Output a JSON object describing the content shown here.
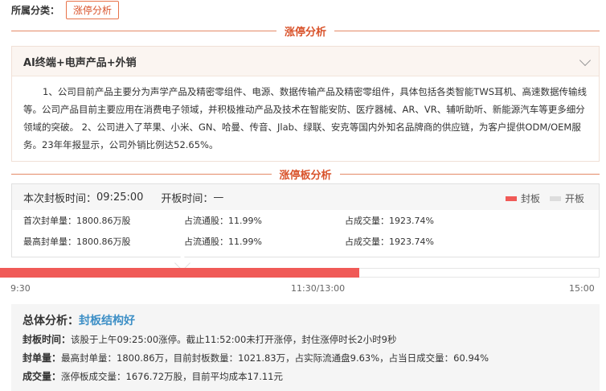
{
  "category": {
    "label": "所属分类：",
    "tag": "涨停分析"
  },
  "section1": {
    "title": "涨停分析"
  },
  "topic": {
    "title": "AI终端+电声产品+外销",
    "body": "1、公司目前产品主要分为声学产品及精密零组件、电源、数据传输产品及精密零组件，具体包括各类智能TWS耳机、高速数据传输线等。公司产品目前主要应用在消费电子领域，并积极推动产品及技术在智能安防、医疗器械、AR、VR、辅听助听、新能源汽车等更多细分领域的突破。 2、公司进入了苹果、小米、GN、哈曼、传音、Jlab、绿联、安克等国内外知名品牌商的供应链，为客户提供ODM/OEM服务。23年年报显示，公司外销比例达52.65%。"
  },
  "section2": {
    "title": "涨停板分析"
  },
  "seal": {
    "seal_time_label": "本次封板时间：",
    "seal_time": "09:25:00",
    "open_time_label": "开板时间：",
    "open_time": "—",
    "legend_seal": "封板",
    "legend_open": "开板",
    "colors": {
      "seal": "#f05a57",
      "open": "#dddddd"
    },
    "rows": [
      [
        "首次封单量：1800.86万股",
        "占流通股：11.99%",
        "占成交量：1923.74%"
      ],
      [
        "最高封单量：1800.86万股",
        "占流通股：11.99%",
        "占成交量：1923.74%"
      ]
    ]
  },
  "timeline": {
    "labels": {
      "start": "9:30",
      "mid": "11:30/13:00",
      "end": "15:00"
    },
    "sealed_fraction": 0.6
  },
  "summary": {
    "title_label": "总体分析：",
    "title_value": "封板结构好",
    "lines": [
      {
        "label": "封板时间：",
        "text": "该股于上午09:25:00涨停。截止11:52:00未打开涨停，封住涨停时长2小时9秒"
      },
      {
        "label": "封单量：",
        "text": "最高封单量：1800.86万，目前封板数量：1021.83万，占实际流通盘9.63%，占当日成交量：60.94%"
      },
      {
        "label": "成交量：",
        "text": "涨停板成交量：1676.72万股，目前平均成本17.11元"
      }
    ]
  }
}
